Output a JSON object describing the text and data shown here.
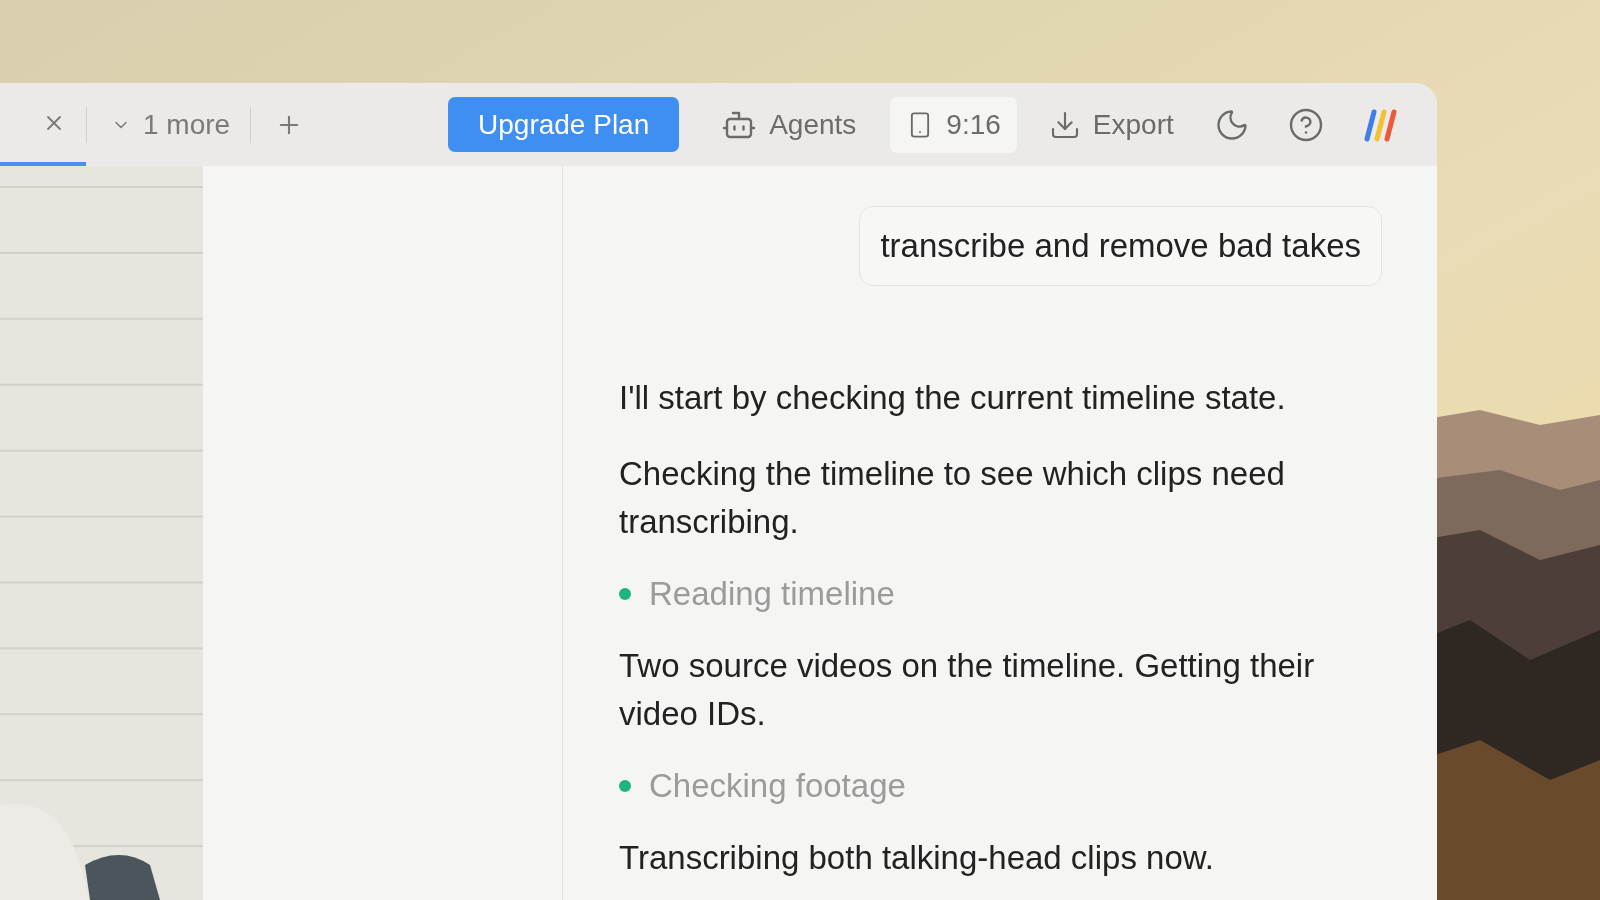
{
  "tab": {
    "selected": true
  },
  "tab_bar": {
    "more": "1 more"
  },
  "toolbar": {
    "upgrade": "Upgrade Plan",
    "agents": "Agents",
    "aspect": "9:16",
    "export": "Export"
  },
  "chat": [
    {
      "kind": "user",
      "text": "transcribe and remove bad takes"
    },
    {
      "kind": "assistant",
      "text": "I'll start by checking the current timeline state."
    },
    {
      "kind": "assistant",
      "text": "Checking the timeline to see which clips need transcribing."
    },
    {
      "kind": "step",
      "text": "Reading timeline",
      "color": "#1cb67e"
    },
    {
      "kind": "assistant",
      "text": "Two source videos on the timeline. Getting their video IDs."
    },
    {
      "kind": "step",
      "text": "Checking footage",
      "color": "#1cb67e"
    },
    {
      "kind": "assistant",
      "text": "Transcribing both talking-head clips now."
    }
  ]
}
